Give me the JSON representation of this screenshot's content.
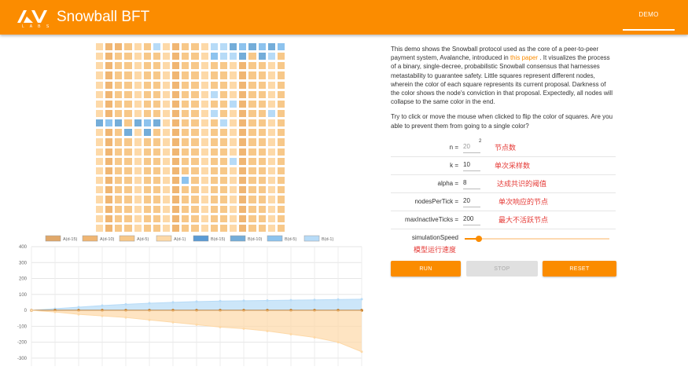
{
  "header": {
    "logo_sub": "L A B S",
    "title": "Snowball BFT",
    "nav_item": "DEMO"
  },
  "colors": {
    "accent": "#fb8c00",
    "annotation": "#e53935",
    "A(d-15)": "#e0a86a",
    "A(d-10)": "#f0b673",
    "A(d-5)": "#f7c889",
    "A(d-1)": "#fdd9a8",
    "B(d-15)": "#5b9bd5",
    "B(d-10)": "#74add9",
    "B(d-5)": "#8dc3ee",
    "B(d-1)": "#b7dbf7"
  },
  "grid": {
    "rows": [
      "AA3AAADAAAAADDBBBBBB",
      "AAAAAAAAAAAABDDBABDA",
      "AAAAAAAAAAAAAAAAAAAA",
      "AAAAAAAAAAAAAAAAAAAA",
      "AAAAAAAAAAAAAAAAAAAA",
      "AAAAAAAAAAAADAAAAAAA",
      "AAAAAAAAAAAAAADAAAAA",
      "AAAAAAAAAAAADAAAAADA",
      "BBBABBBAAAAAADAAAAAA",
      "AAABABAAAAAAAAAAAAAA",
      "AAAAAAAAAAAAAAAAAAAA",
      "AAAAAAAAAAAAAAAAAAAA",
      "AAAAAAAAAAAAAADAAAAA",
      "AAAAAAAAAAAAAAAAAAAA",
      "AAAAAAAAABAAAAAAAAAA",
      "AAAAAAAAAAAAAAAAAAAA",
      "AAAAAAAAAAAAAAAAAAAA",
      "AAAAAAAAAAAAAAAAAAAA",
      "AAAAAAAAAAAAAAAAAAAA",
      "AAAAAAAAAAAAAAAAAAAA"
    ]
  },
  "chart_data": {
    "type": "area",
    "legend": [
      "A(d-15)",
      "A(d-10)",
      "A(d-5)",
      "A(d-1)",
      "B(d-15)",
      "B(d-10)",
      "B(d-5)",
      "B(d-1)"
    ],
    "legend_placement": "top",
    "y_ticks": [
      "400",
      "300",
      "200",
      "100",
      "0",
      "-100",
      "-200",
      "-300"
    ],
    "ylim": [
      -350,
      400
    ],
    "grid": true,
    "x": [
      0,
      1,
      2,
      3,
      4,
      5,
      6,
      7,
      8,
      9,
      10,
      11,
      12,
      13,
      14
    ],
    "series": [
      {
        "name": "B(d-1)",
        "values": [
          0,
          10,
          20,
          30,
          38,
          45,
          50,
          55,
          58,
          60,
          62,
          64,
          66,
          68,
          70
        ]
      },
      {
        "name": "A(d-15)",
        "values": [
          0,
          0,
          0,
          0,
          0,
          0,
          0,
          0,
          0,
          0,
          0,
          0,
          0,
          0,
          0
        ]
      },
      {
        "name": "A(d-1)",
        "values": [
          0,
          -10,
          -25,
          -35,
          -45,
          -60,
          -75,
          -90,
          -105,
          -115,
          -130,
          -150,
          -170,
          -200,
          -260
        ]
      }
    ]
  },
  "description": {
    "p1_before": "This demo shows the Snowball protocol used as the core of a peer-to-peer payment system, Avalanche, introduced in ",
    "p1_link": "this paper",
    "p1_after": " . It visualizes the process of a binary, single-decree, probabilistic Snowball consensus that harnesses metastability to guarantee safety. Little squares represent different nodes, wherein the color of each square represents its current proposal. Darkness of the color shows the node's conviction in that proposal. Expectedly, all nodes will collapse to the same color in the end.",
    "p2": "Try to click or move the mouse when clicked to flip the color of squares. Are you able to prevent them from going to a single color?"
  },
  "params": {
    "n": {
      "label": "n =",
      "value": "20",
      "sup": "2",
      "note": "节点数"
    },
    "k": {
      "label": "k =",
      "value": "10",
      "note": "单次采样数"
    },
    "alpha": {
      "label": "alpha =",
      "value": "8",
      "note": "达成共识的阈值"
    },
    "nodesPerTick": {
      "label": "nodesPerTick =",
      "value": "20",
      "note": "单次响应的节点"
    },
    "maxInactiveTicks": {
      "label": "maxInactiveTicks =",
      "value": "200",
      "note": "最大不活跃节点"
    }
  },
  "speed": {
    "label": "simulationSpeed",
    "note": "模型运行速度",
    "value_fraction": 0.1
  },
  "buttons": {
    "run": "RUN",
    "stop": "STOP",
    "reset": "RESET"
  }
}
